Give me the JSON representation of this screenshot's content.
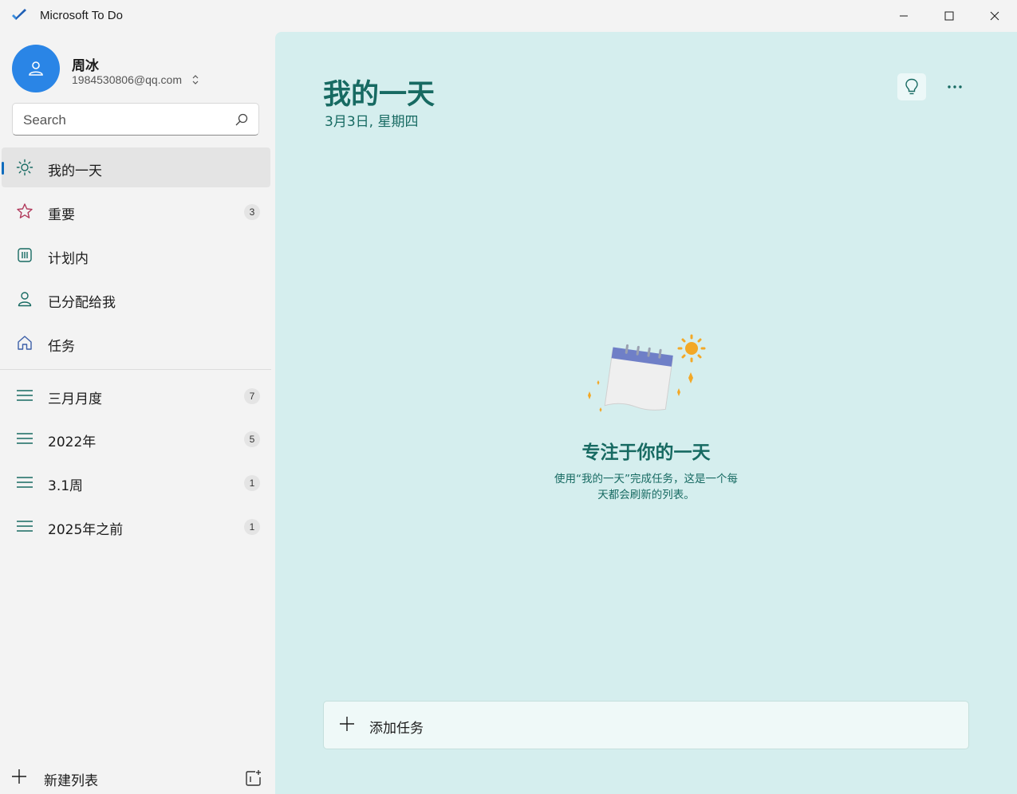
{
  "window": {
    "title": "Microsoft To Do"
  },
  "account": {
    "name": "周冰",
    "email": "1984530806@qq.com"
  },
  "search": {
    "placeholder": "Search"
  },
  "nav": [
    {
      "label": "我的一天",
      "icon": "sun-icon",
      "active": true
    },
    {
      "label": "重要",
      "icon": "star-icon",
      "count": "3"
    },
    {
      "label": "计划内",
      "icon": "calendar-grid-icon"
    },
    {
      "label": "已分配给我",
      "icon": "person-icon"
    },
    {
      "label": "任务",
      "icon": "home-icon"
    }
  ],
  "lists": [
    {
      "label": "三月月度",
      "icon": "list-icon",
      "count": "7"
    },
    {
      "label": "2022年",
      "icon": "list-icon",
      "count": "5"
    },
    {
      "label": "3.1周",
      "icon": "list-icon",
      "count": "1"
    },
    {
      "label": "2025年之前",
      "icon": "list-icon",
      "count": "1"
    }
  ],
  "new_list": {
    "label": "新建列表"
  },
  "main": {
    "title": "我的一天",
    "date": "3月3日, 星期四",
    "empty_title": "专注于你的一天",
    "empty_desc_line1": "使用“我的一天”完成任务，这是一个每",
    "empty_desc_line2": "天都会刷新的列表。",
    "add_task_label": "添加任务"
  },
  "colors": {
    "accent": "#176a62",
    "main_bg": "#d5eeee",
    "avatar": "#2a85e6",
    "active_bar": "#0f6cbd"
  }
}
